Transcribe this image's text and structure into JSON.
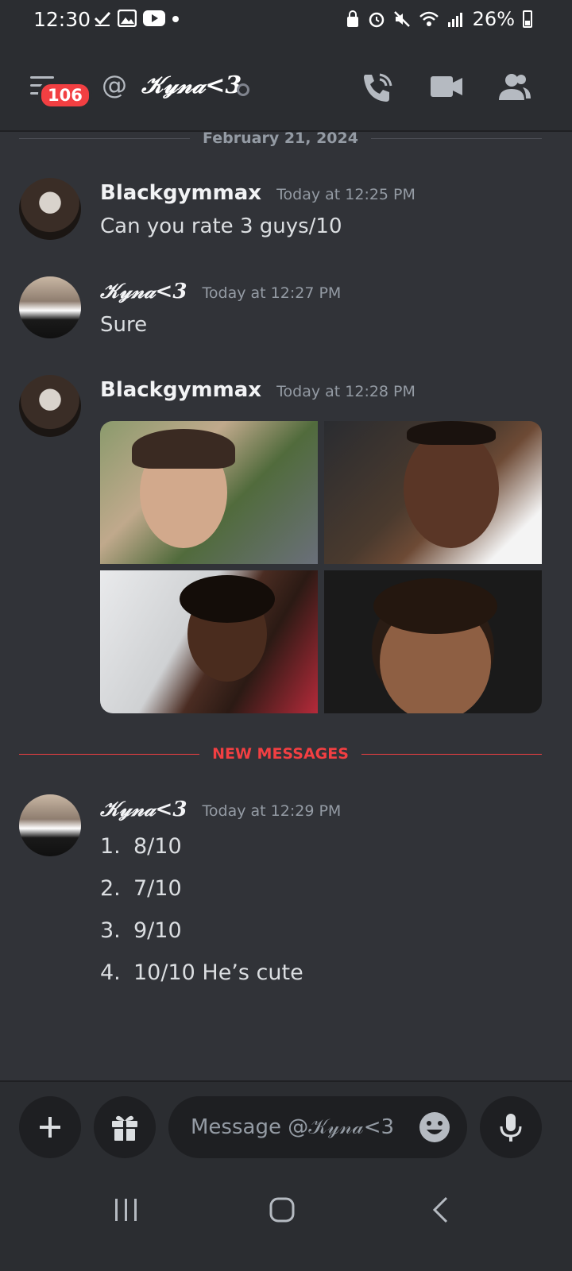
{
  "status_bar": {
    "time": "12:30",
    "battery": "26%"
  },
  "header": {
    "unread_count": "106",
    "dm_name": "𝒦𝓎𝓃𝒶<3"
  },
  "date_divider": "February 21, 2024",
  "messages": [
    {
      "author": "Blackgymmax",
      "timestamp": "Today at 12:25 PM",
      "text": "Can you rate 3 guys/10"
    },
    {
      "author": "𝒦𝓎𝓃𝒶<3",
      "timestamp": "Today at 12:27 PM",
      "text": "Sure"
    },
    {
      "author": "Blackgymmax",
      "timestamp": "Today at 12:28 PM"
    },
    {
      "author": "𝒦𝓎𝓃𝒶<3",
      "timestamp": "Today at 12:29 PM",
      "list": [
        {
          "num": "1.",
          "text": "8/10"
        },
        {
          "num": "2.",
          "text": "7/10"
        },
        {
          "num": "3.",
          "text": "9/10"
        },
        {
          "num": "4.",
          "text": "10/10 He’s cute"
        }
      ]
    }
  ],
  "new_messages_label": "NEW MESSAGES",
  "composer": {
    "placeholder": "Message @𝒦𝓎𝓃𝒶<3"
  }
}
